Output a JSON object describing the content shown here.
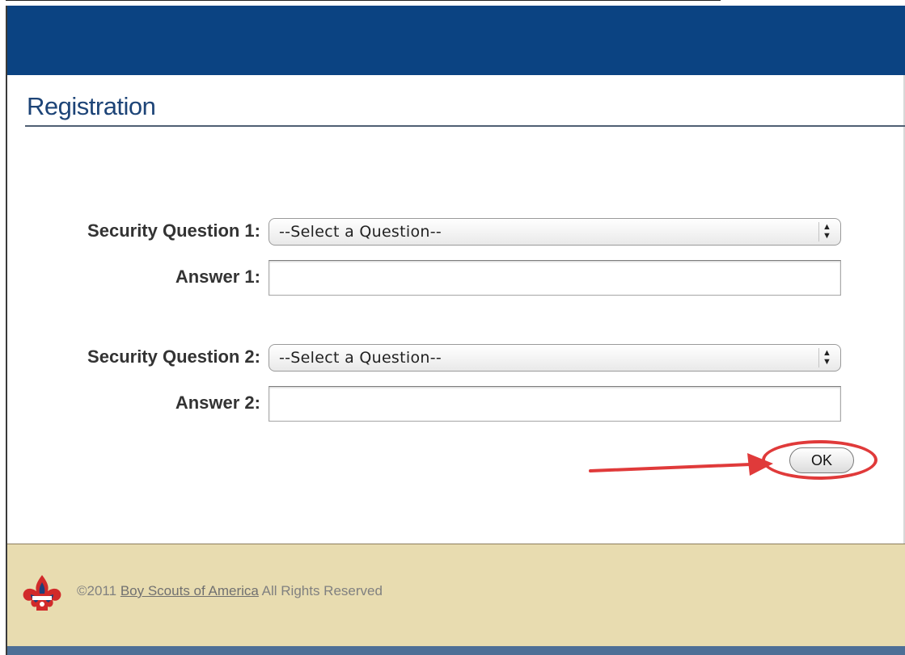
{
  "header": {
    "brand_color": "#0b4382"
  },
  "page": {
    "title": "Registration"
  },
  "form": {
    "question1": {
      "label": "Security Question 1:",
      "selected": "--Select a Question--"
    },
    "answer1": {
      "label": "Answer 1:",
      "value": ""
    },
    "question2": {
      "label": "Security Question 2:",
      "selected": "--Select a Question--"
    },
    "answer2": {
      "label": "Answer 2:",
      "value": ""
    },
    "ok_label": "OK"
  },
  "annotation": {
    "color": "#e03a3a",
    "target": "ok-button"
  },
  "footer": {
    "copyright": "©2011",
    "link_text": "Boy Scouts of America",
    "rights": "All Rights Reserved",
    "logo_icon": "fleur-de-lis-icon"
  }
}
